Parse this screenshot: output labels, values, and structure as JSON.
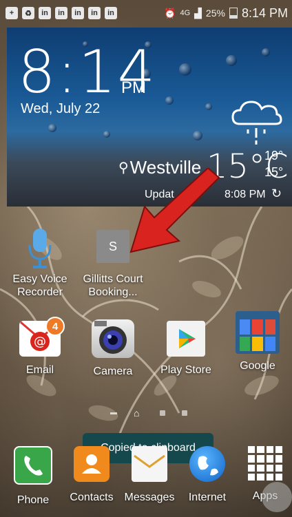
{
  "status_bar": {
    "battery": "25%",
    "network": "4G",
    "time": "8:14 PM",
    "icons": [
      "add-box-icon",
      "recycle-icon",
      "linkedin-icon",
      "linkedin-icon",
      "linkedin-icon",
      "linkedin-icon",
      "linkedin-icon",
      "alarm-icon",
      "signal-icon",
      "battery-icon"
    ]
  },
  "widget": {
    "time": "8:14",
    "ampm": "PM",
    "date": "Wed, July 22",
    "city": "Westville",
    "temp": "15°C",
    "high": "19°",
    "low": "15°",
    "updated_label": "Updat",
    "updated_time": "8:08 PM",
    "weather_icon": "cloud-rain-icon"
  },
  "apps": [
    {
      "label": "Easy Voice\nRecorder",
      "line1": "Easy Voice",
      "line2": "Recorder",
      "icon": "microphone-icon"
    },
    {
      "label": "Gillitts Court Booking...",
      "line1": "Gillitts Court",
      "line2": "Booking...",
      "icon": "shortcut-s-icon",
      "glyph": "S"
    },
    {
      "label": "Email",
      "icon": "email-icon",
      "badge": "4"
    },
    {
      "label": "Camera",
      "icon": "camera-icon"
    },
    {
      "label": "Play Store",
      "icon": "play-store-icon"
    },
    {
      "label": "Google",
      "icon": "google-folder-icon"
    }
  ],
  "toast": "Copied to clipboard",
  "dock": [
    {
      "label": "Phone",
      "icon": "phone-icon"
    },
    {
      "label": "Contacts",
      "icon": "contacts-icon"
    },
    {
      "label": "Messages",
      "icon": "messages-icon"
    },
    {
      "label": "Internet",
      "icon": "globe-icon"
    },
    {
      "label": "Apps",
      "icon": "apps-grid-icon"
    }
  ],
  "colors": {
    "email_badge": "#ef7a25",
    "toast_bg": "#15484d",
    "arrow": "#d8231f",
    "phone": "#3aa64a",
    "contacts": "#f08a1c"
  }
}
